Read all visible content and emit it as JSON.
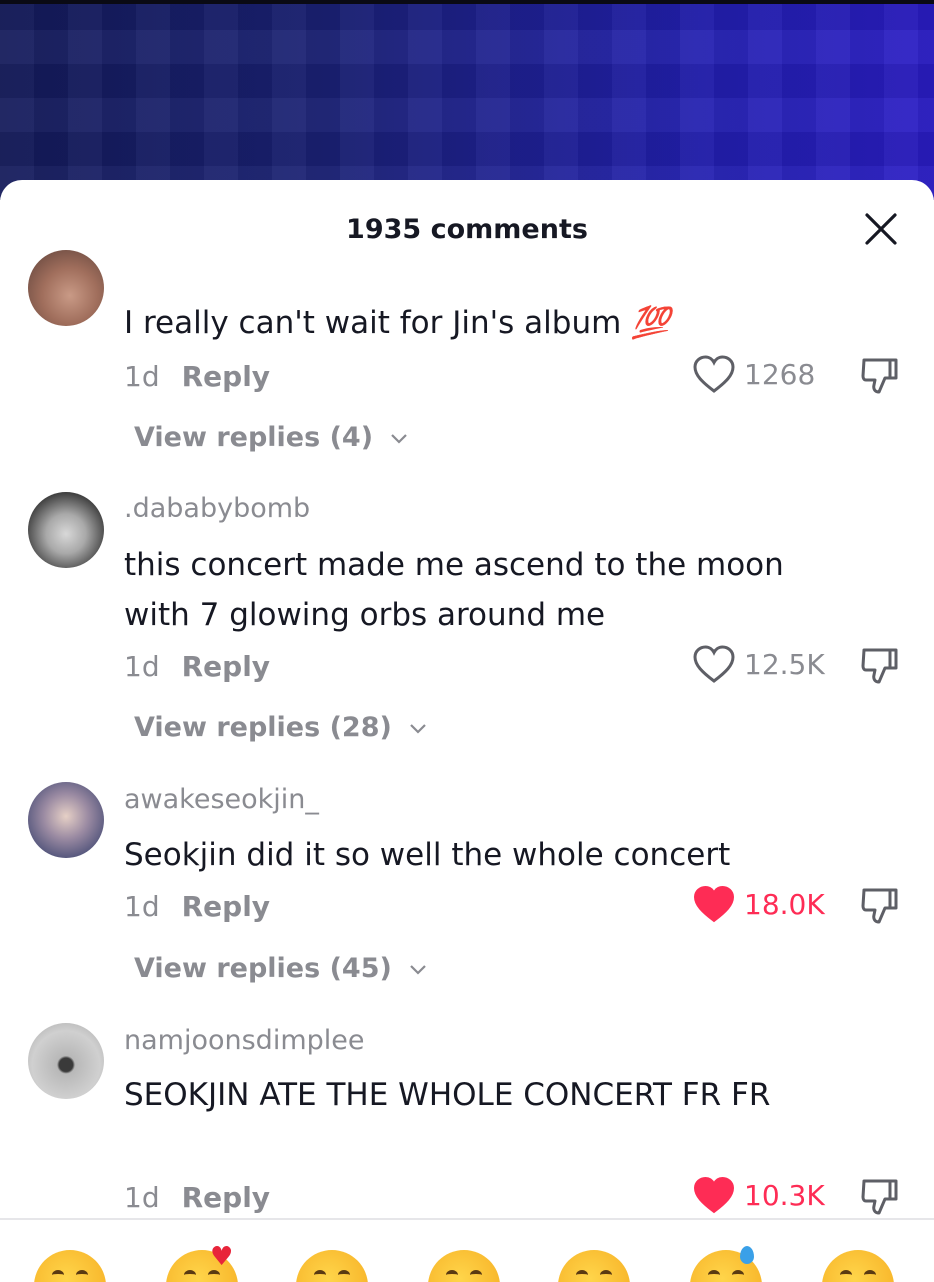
{
  "sheet": {
    "title": "1935 comments"
  },
  "comments": [
    {
      "username": "",
      "text": "I really can't wait for Jin's album",
      "text_emoji": "💯",
      "time": "1d",
      "reply_label": "Reply",
      "likes": "1268",
      "liked": false,
      "view_replies": "View replies (4)"
    },
    {
      "username": ".dababybomb",
      "text": "this concert made me ascend to the moon with 7 glowing orbs around me",
      "time": "1d",
      "reply_label": "Reply",
      "likes": "12.5K",
      "liked": false,
      "view_replies": "View replies (28)"
    },
    {
      "username": "awakeseokjin_",
      "text": "Seokjin did it so well the whole concert",
      "time": "1d",
      "reply_label": "Reply",
      "likes": "18.0K",
      "liked": true,
      "view_replies": "View replies (45)"
    },
    {
      "username": "namjoonsdimplee",
      "text": "SEOKJIN ATE THE WHOLE CONCERT FR FR",
      "time": "1d",
      "reply_label": "Reply",
      "likes": "10.3K",
      "liked": true
    }
  ],
  "colors": {
    "liked": "#fe2c55",
    "muted": "#8a8b91",
    "text": "#161823"
  },
  "emoji_bar": [
    "smile",
    "smiling-face-with-hearts",
    "smiling-face-with-smiling-eyes",
    "smiling-face",
    "smirk",
    "grinning-sweat",
    "pleading"
  ]
}
